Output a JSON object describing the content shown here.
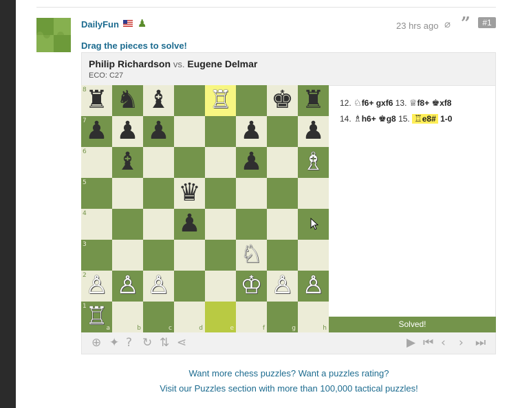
{
  "post": {
    "username": "DailyFun",
    "timestamp": "23 hrs ago",
    "post_number": "#1",
    "instruction": "Drag the pieces to solve!"
  },
  "game": {
    "white_player": "Philip Richardson",
    "vs": "vs.",
    "black_player": "Eugene Delmar",
    "eco": "ECO: C27"
  },
  "board": {
    "ranks": [
      "8",
      "7",
      "6",
      "5",
      "4",
      "3",
      "2",
      "1"
    ],
    "files": [
      "a",
      "b",
      "c",
      "d",
      "e",
      "f",
      "g",
      "h"
    ],
    "position": [
      [
        "bR",
        "bN",
        "bB",
        "",
        "wR",
        "",
        "bK",
        "bR"
      ],
      [
        "bP",
        "bP",
        "bP",
        "",
        "",
        "bP",
        "",
        "bP"
      ],
      [
        "",
        "bB",
        "",
        "",
        "",
        "bP",
        "",
        "wB"
      ],
      [
        "",
        "",
        "",
        "bQ",
        "",
        "",
        "",
        ""
      ],
      [
        "",
        "",
        "",
        "bP",
        "",
        "",
        "",
        ""
      ],
      [
        "",
        "",
        "",
        "",
        "",
        "wN",
        "",
        ""
      ],
      [
        "wP",
        "wP",
        "wP",
        "",
        "",
        "wK",
        "wP",
        "wP"
      ],
      [
        "wR",
        "",
        "",
        "",
        "",
        "",
        "",
        ""
      ]
    ],
    "highlighted_squares": [
      "e8",
      "e1"
    ],
    "piece_glyphs": {
      "wK": "♔",
      "wQ": "♕",
      "wR": "♖",
      "wB": "♗",
      "wN": "♘",
      "wP": "♙",
      "bK": "♚",
      "bQ": "♛",
      "bR": "♜",
      "bB": "♝",
      "bN": "♞",
      "bP": "♟"
    }
  },
  "moves": {
    "line1": {
      "n12": "12.",
      "m12w_piece": "♘",
      "m12w": "f6+",
      "m12b": "gxf6",
      "n13": "13.",
      "m13w_piece": "♕",
      "m13w": "f8+",
      "m13b_piece": "♚",
      "m13b": "xf8"
    },
    "line2": {
      "n14": "14.",
      "m14w_piece": "♗",
      "m14w": "h6+",
      "m14b_piece": "♚",
      "m14b": "g8",
      "n15": "15.",
      "m15w_piece": "♖",
      "m15w": "e8#",
      "result": "1-0"
    }
  },
  "status": {
    "solved": "Solved!"
  },
  "controls": {
    "left": [
      "analysis-icon",
      "hint-icon",
      "help-icon",
      "retry-icon",
      "flip-board-icon",
      "share-icon"
    ],
    "right": [
      "play-icon",
      "first-move-icon",
      "previous-move-icon",
      "next-move-icon",
      "last-move-icon"
    ]
  },
  "promo": {
    "line1": "Want more chess puzzles? Want a puzzles rating?",
    "line2": "Visit our Puzzles section with more than 100,000 tactical puzzles!"
  },
  "colors": {
    "light_square": "#ececd7",
    "dark_square": "#74944b",
    "link_blue": "#1c6b8f",
    "move_highlight": "#ffee58"
  }
}
